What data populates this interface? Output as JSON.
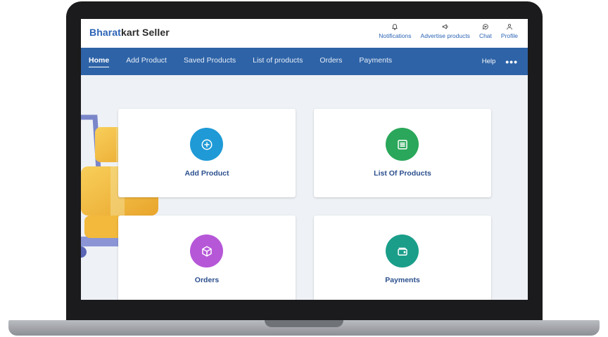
{
  "brand": {
    "part1": "Bharat",
    "part2": "kart Seller"
  },
  "top_actions": [
    {
      "label": "Notifications",
      "icon": "bell-icon"
    },
    {
      "label": "Advertise products",
      "icon": "megaphone-icon"
    },
    {
      "label": "Chat",
      "icon": "chat-icon"
    },
    {
      "label": "Profile",
      "icon": "user-icon"
    }
  ],
  "nav": {
    "items": [
      "Home",
      "Add Product",
      "Saved Products",
      "List of products",
      "Orders",
      "Payments"
    ],
    "active": "Home",
    "help": "Help",
    "more": "•••"
  },
  "cards": [
    {
      "label": "Add Product",
      "icon": "plus-circle-icon",
      "color": "#1f9ad6"
    },
    {
      "label": "List Of Products",
      "icon": "list-icon",
      "color": "#2aa75a"
    },
    {
      "label": "Orders",
      "icon": "box-icon",
      "color": "#b657d8"
    },
    {
      "label": "Payments",
      "icon": "wallet-icon",
      "color": "#1a9e8a"
    }
  ],
  "colors": {
    "brand_blue": "#2c64b5",
    "nav_bg": "#2e63a7",
    "content_bg": "#eef1f5"
  }
}
